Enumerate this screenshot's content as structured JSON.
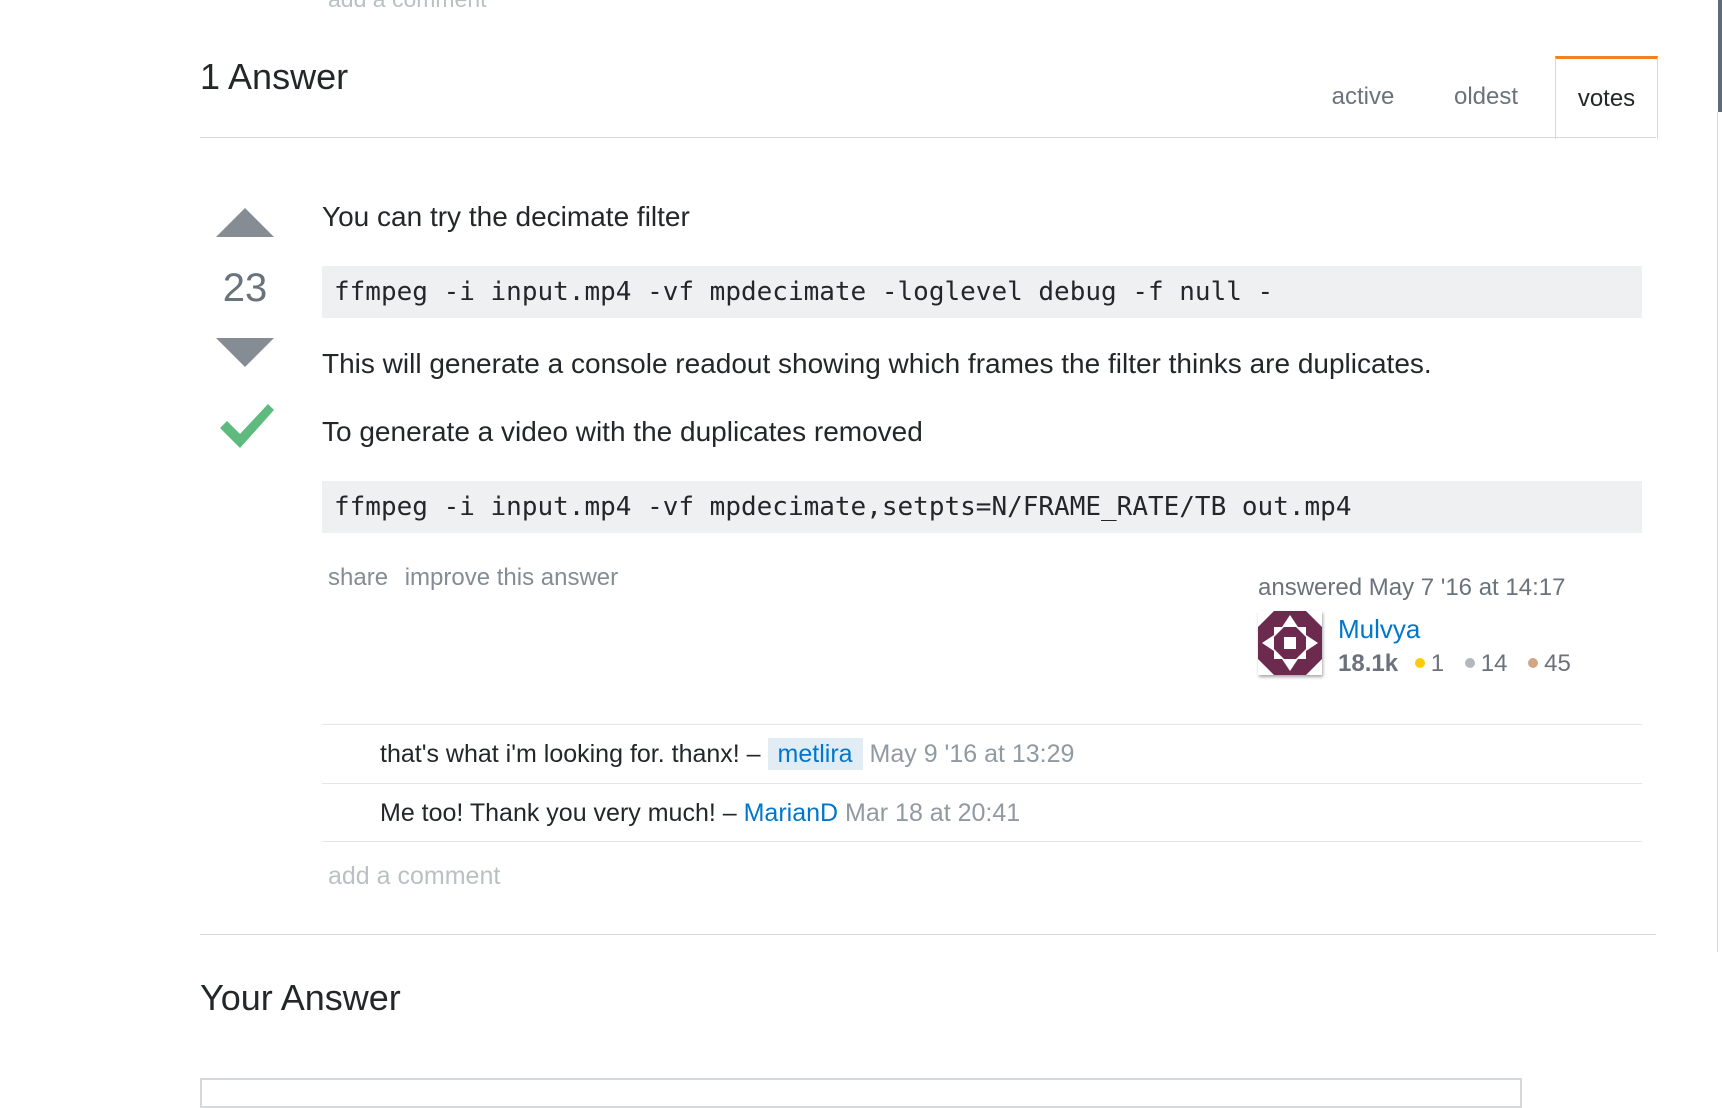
{
  "previous_section": {
    "add_comment": "add a comment"
  },
  "answers_header": {
    "title": "1 Answer",
    "sort_tabs": [
      {
        "label": "active",
        "selected": false
      },
      {
        "label": "oldest",
        "selected": false
      },
      {
        "label": "votes",
        "selected": true
      }
    ]
  },
  "answer": {
    "vote_count": "23",
    "accepted": true,
    "paragraphs": [
      "You can try the decimate filter",
      "This will generate a console readout showing which frames the filter thinks are duplicates.",
      "To generate a video with the duplicates removed"
    ],
    "code_blocks": [
      "ffmpeg -i input.mp4 -vf mpdecimate -loglevel debug -f null -",
      "ffmpeg -i input.mp4 -vf mpdecimate,setpts=N/FRAME_RATE/TB out.mp4"
    ],
    "menu": {
      "share": "share",
      "improve": "improve this answer"
    },
    "signature": {
      "action_time": "answered May 7 '16 at 14:17",
      "user_name": "Mulvya",
      "reputation": "18.1k",
      "badges": {
        "gold": "1",
        "silver": "14",
        "bronze": "45"
      }
    },
    "comments": [
      {
        "text": "that's what i'm looking for. thanx! –",
        "user": "metlira",
        "date": "May 9 '16 at 13:29"
      },
      {
        "text": "Me too! Thank you very much! –",
        "user": "MarianD",
        "date": "Mar 18 at 20:41"
      }
    ],
    "add_comment": "add a comment"
  },
  "your_answer": {
    "title": "Your Answer"
  },
  "colors": {
    "accent_tab": "#f48024",
    "link": "#0077cc",
    "accepted_check": "#5eba7d",
    "code_bg": "#eff0f1"
  },
  "icons": {
    "vote_up": "triangle-up-icon",
    "vote_down": "triangle-down-icon",
    "accepted": "checkmark-icon"
  }
}
